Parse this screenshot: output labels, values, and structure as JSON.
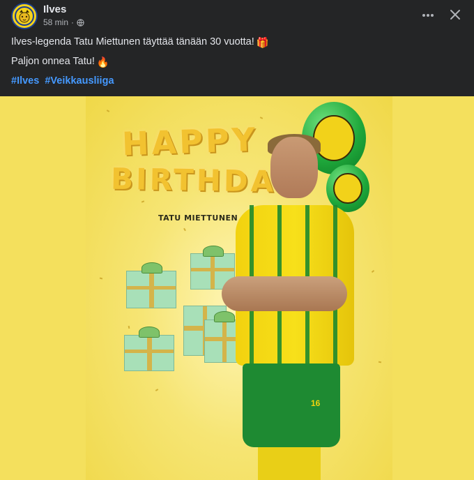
{
  "post": {
    "author": "Ilves",
    "time": "58 min",
    "separator": "·",
    "text_line1": "Ilves-legenda Tatu Miettunen täyttää tänään 30 vuotta!",
    "text_line2": "Paljon onnea Tatu!",
    "hashtags": [
      "#Ilves",
      "#Veikkausliiga"
    ],
    "emoji_gift": "🎁",
    "emoji_fire": "🔥"
  },
  "media": {
    "headline_happy": "HAPPY",
    "headline_birthday": "BIRTHDAY",
    "player_name": "TATU MIETTUNEN",
    "shirt_number": "16"
  },
  "colors": {
    "background": "#242526",
    "text": "#e4e6eb",
    "muted": "#b0b3b8",
    "link": "#4599ff",
    "media_yellow": "#f4e05d",
    "club_green": "#1fa83b"
  },
  "icons": {
    "privacy": "globe-icon",
    "more": "more-options-icon",
    "close": "close-icon"
  }
}
